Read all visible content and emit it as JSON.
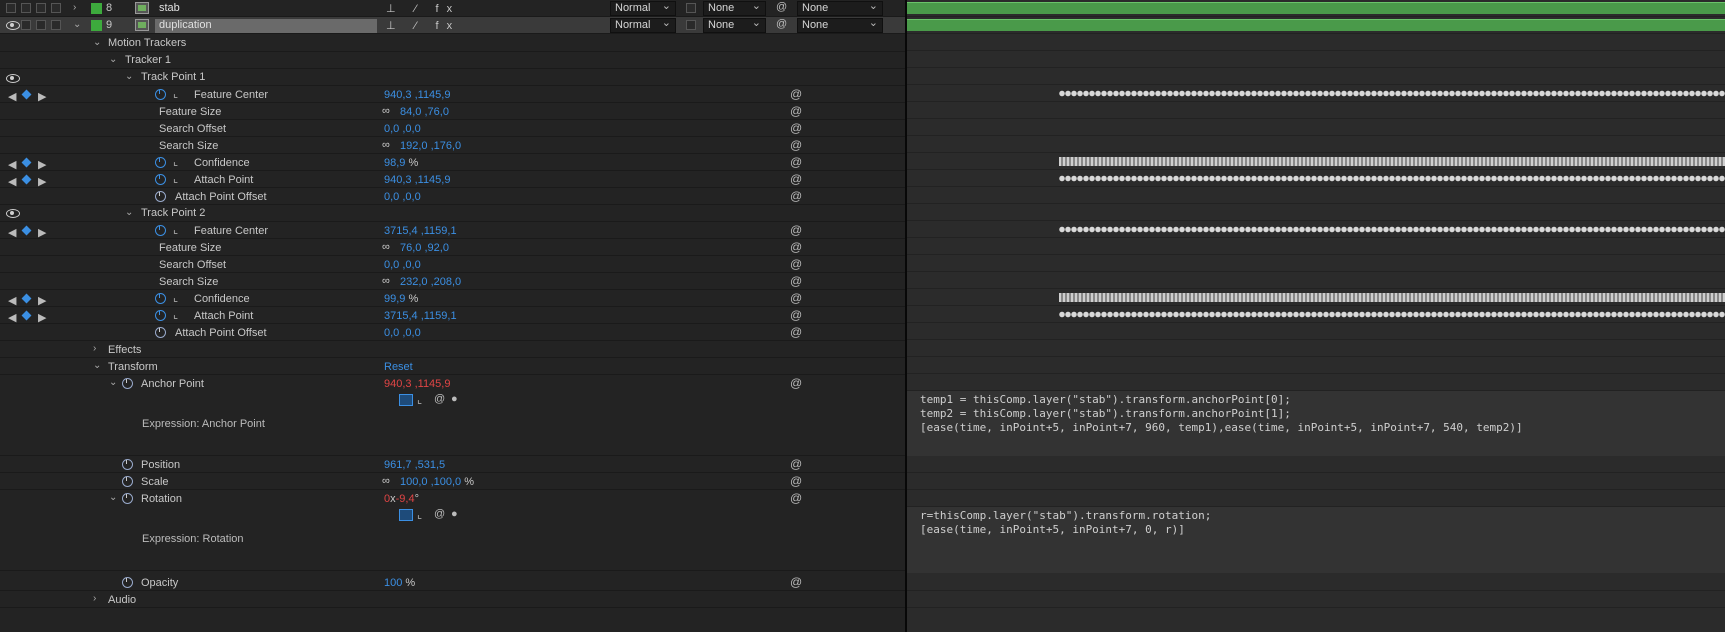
{
  "layers": [
    {
      "num": "8",
      "name": "stab",
      "mode": "Normal",
      "trkmat": "None",
      "parent": "None"
    },
    {
      "num": "9",
      "name": "duplication",
      "mode": "Normal",
      "trkmat": "None",
      "parent": "None"
    }
  ],
  "icons_row": "⊥ ⁄ fx",
  "groups": {
    "motion_trackers": "Motion Trackers",
    "tracker1": "Tracker 1",
    "tp1": "Track Point 1",
    "tp2": "Track Point 2",
    "effects": "Effects",
    "transform": "Transform",
    "audio": "Audio",
    "reset": "Reset"
  },
  "tp1": {
    "feature_center": {
      "label": "Feature Center",
      "value": "940,3 ,1145,9"
    },
    "feature_size": {
      "label": "Feature Size",
      "value": "84,0 ,76,0"
    },
    "search_offset": {
      "label": "Search Offset",
      "value": "0,0 ,0,0"
    },
    "search_size": {
      "label": "Search Size",
      "value": "192,0 ,176,0"
    },
    "confidence": {
      "label": "Confidence",
      "value": "98,9",
      "unit": "%"
    },
    "attach_point": {
      "label": "Attach Point",
      "value": "940,3 ,1145,9"
    },
    "attach_offset": {
      "label": "Attach Point Offset",
      "value": "0,0 ,0,0"
    }
  },
  "tp2": {
    "feature_center": {
      "label": "Feature Center",
      "value": "3715,4 ,1159,1"
    },
    "feature_size": {
      "label": "Feature Size",
      "value": "76,0 ,92,0"
    },
    "search_offset": {
      "label": "Search Offset",
      "value": "0,0 ,0,0"
    },
    "search_size": {
      "label": "Search Size",
      "value": "232,0 ,208,0"
    },
    "confidence": {
      "label": "Confidence",
      "value": "99,9",
      "unit": "%"
    },
    "attach_point": {
      "label": "Attach Point",
      "value": "3715,4 ,1159,1"
    },
    "attach_offset": {
      "label": "Attach Point Offset",
      "value": "0,0 ,0,0"
    }
  },
  "transform": {
    "anchor": {
      "label": "Anchor Point",
      "value": "940,3 ,1145,9",
      "expr_label": "Expression: Anchor Point"
    },
    "position": {
      "label": "Position",
      "value": "961,7 ,531,5"
    },
    "scale": {
      "label": "Scale",
      "value": "100,0 ,100,0",
      "unit": "%"
    },
    "rotation": {
      "label": "Rotation",
      "v1": "0",
      "x": "x",
      "v2": "-9,4",
      "unit": "°",
      "expr_label": "Expression: Rotation"
    },
    "opacity": {
      "label": "Opacity",
      "value": "100",
      "unit": "%"
    }
  },
  "expr_anchor": [
    "temp1 = thisComp.layer(\"stab\").transform.anchorPoint[0];",
    "temp2 = thisComp.layer(\"stab\").transform.anchorPoint[1];",
    "[ease(time, inPoint+5, inPoint+7, 960, temp1),ease(time, inPoint+5, inPoint+7, 540, temp2)]"
  ],
  "expr_rotation": [
    "r=thisComp.layer(\"stab\").transform.rotation;",
    "[ease(time, inPoint+5, inPoint+7, 0, r)]"
  ],
  "colors": {
    "accent": "#3b8fe3",
    "label_green": "#3daa3d",
    "keyframe_red": "#e04545",
    "bar_green": "#4a9a4a"
  }
}
